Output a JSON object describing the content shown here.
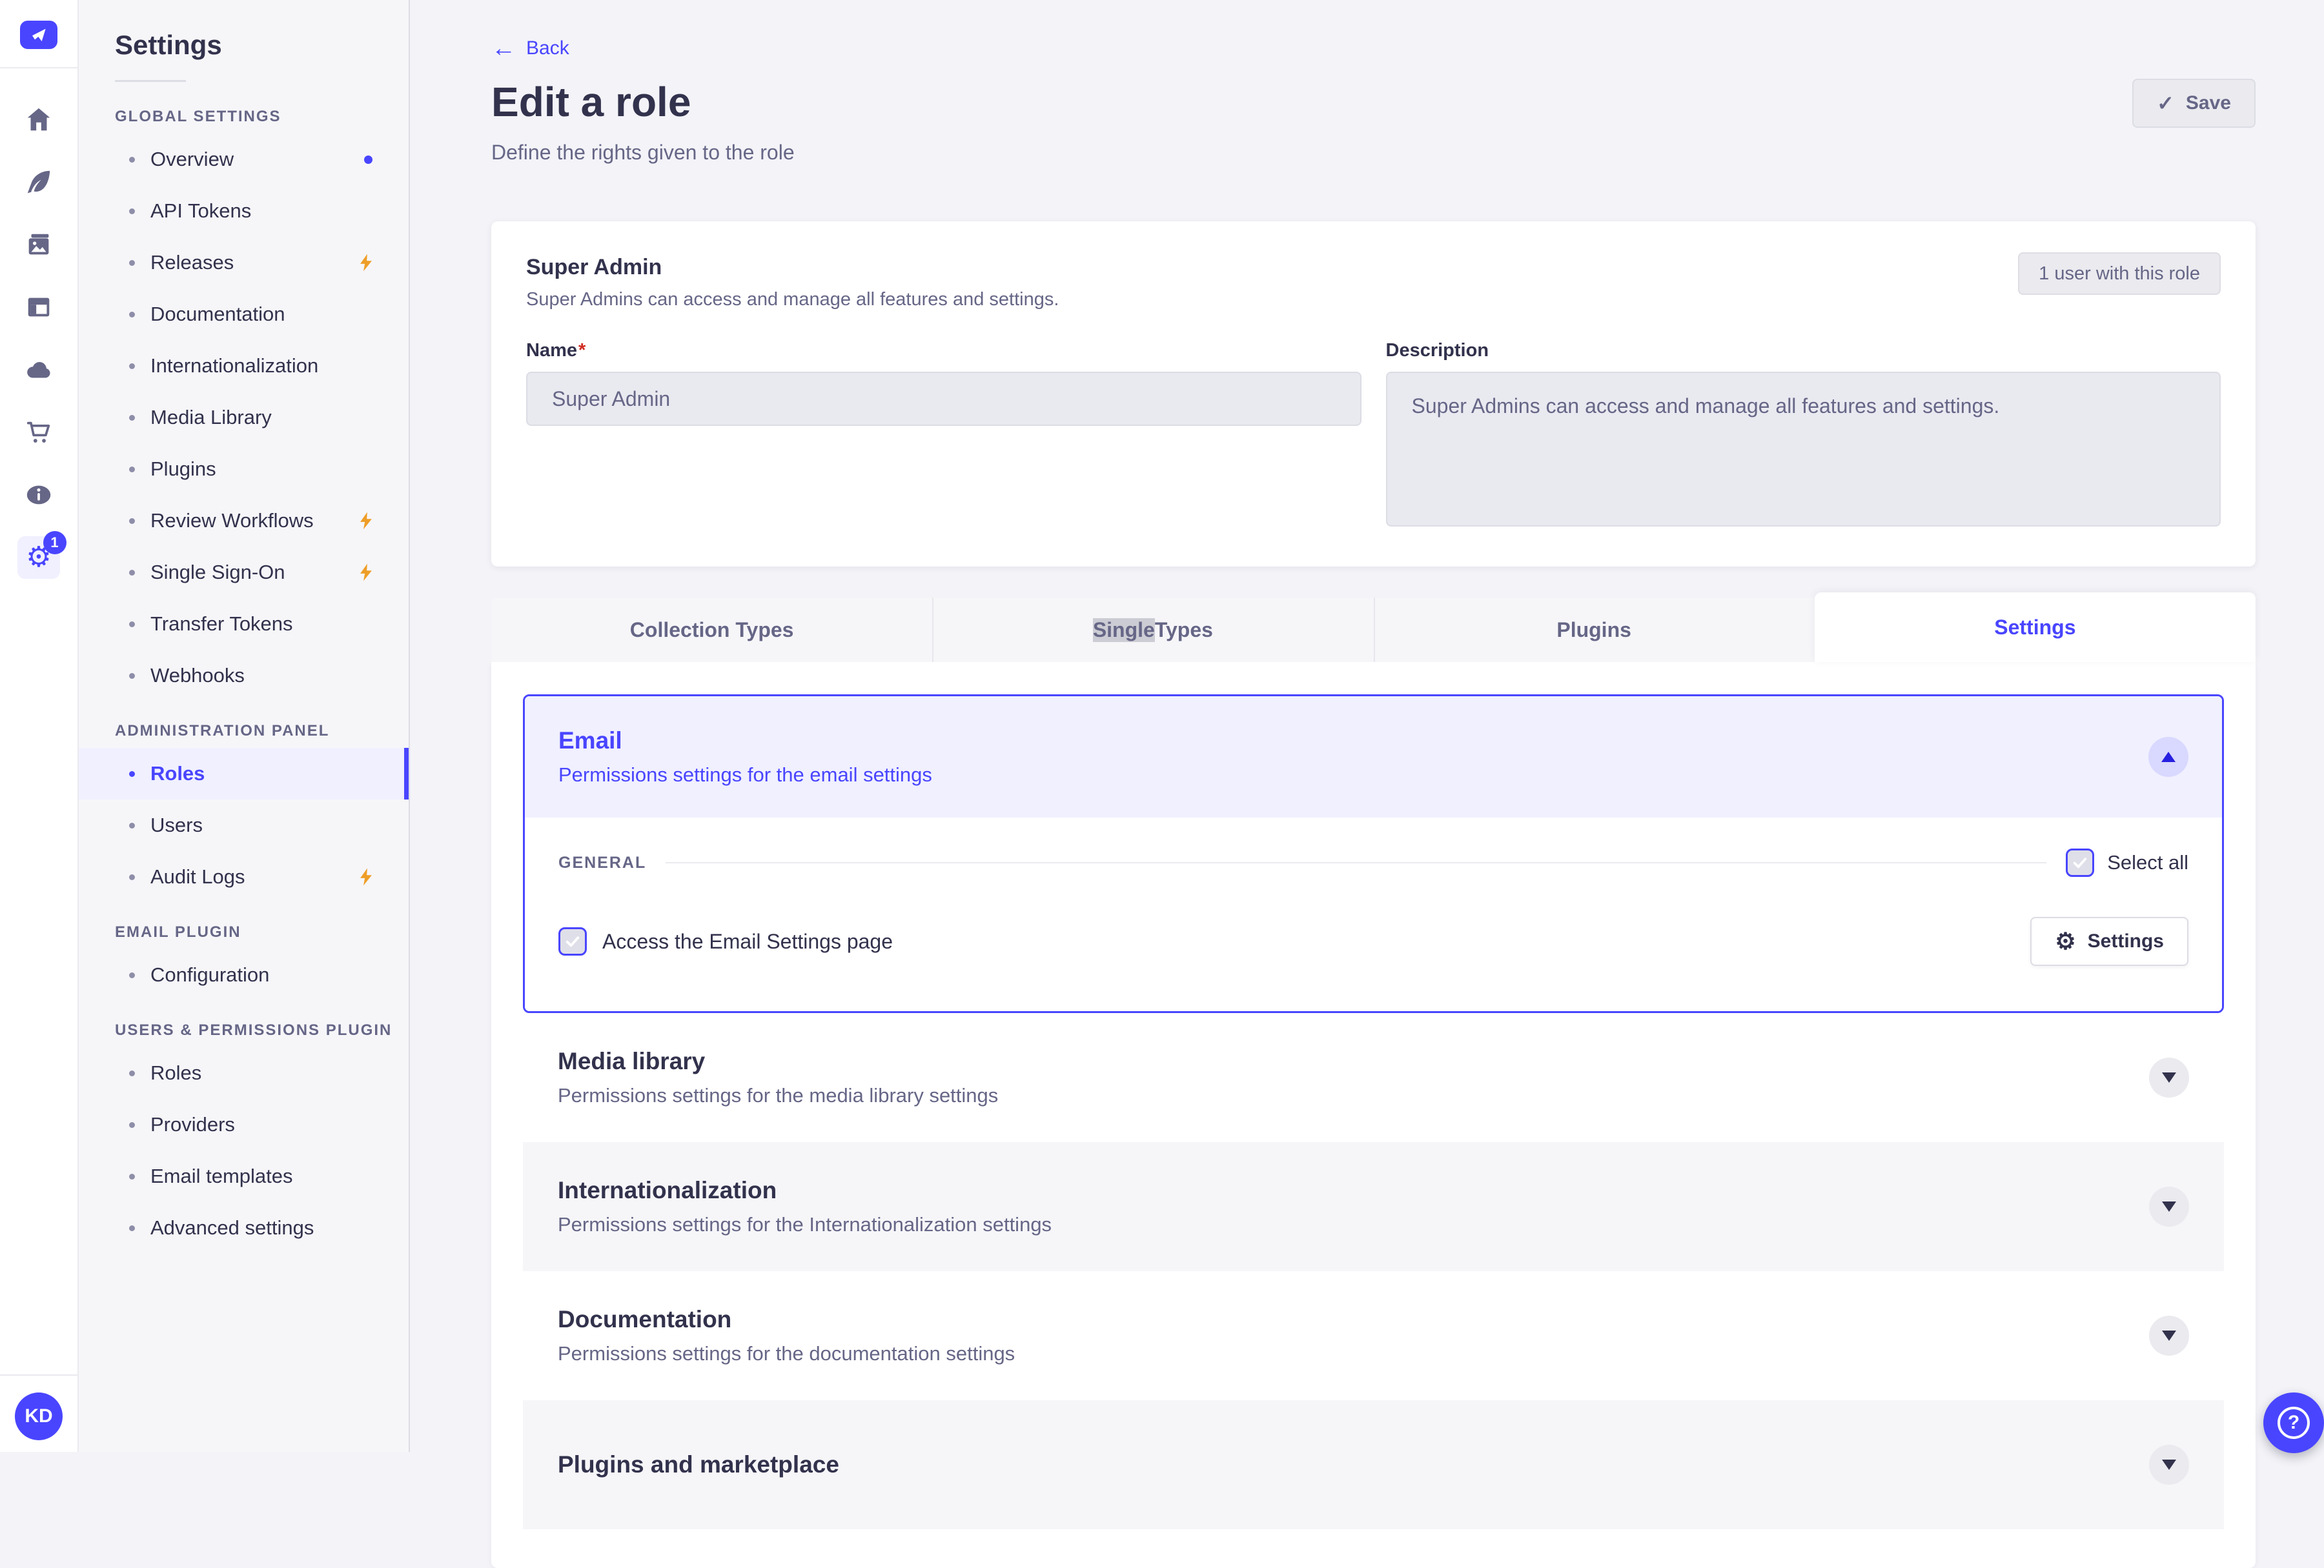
{
  "colors": {
    "accent": "#4945FF",
    "accent_bg": "#F0F0FF",
    "bolt_orange": "#EE9E27",
    "required_red": "#D02B20",
    "text_dark": "#32324D",
    "text_muted": "#666687",
    "page_bg": "#F6F6F9"
  },
  "nav_rail": {
    "icons": [
      {
        "name": "home-icon"
      },
      {
        "name": "content-manager-icon"
      },
      {
        "name": "media-library-icon"
      },
      {
        "name": "content-type-builder-icon"
      },
      {
        "name": "cloud-icon"
      },
      {
        "name": "marketplace-icon"
      },
      {
        "name": "information-icon"
      },
      {
        "name": "settings-icon",
        "active": true,
        "badge": "1"
      }
    ],
    "avatar_initials": "KD"
  },
  "sidebar": {
    "title": "Settings",
    "sections": [
      {
        "header": "GLOBAL SETTINGS",
        "items": [
          {
            "label": "Overview",
            "notification": true
          },
          {
            "label": "API Tokens"
          },
          {
            "label": "Releases",
            "lightning": true
          },
          {
            "label": "Documentation"
          },
          {
            "label": "Internationalization"
          },
          {
            "label": "Media Library"
          },
          {
            "label": "Plugins"
          },
          {
            "label": "Review Workflows",
            "lightning": true
          },
          {
            "label": "Single Sign-On",
            "lightning": true
          },
          {
            "label": "Transfer Tokens"
          },
          {
            "label": "Webhooks"
          }
        ]
      },
      {
        "header": "ADMINISTRATION PANEL",
        "items": [
          {
            "label": "Roles",
            "active": true
          },
          {
            "label": "Users"
          },
          {
            "label": "Audit Logs",
            "lightning": true
          }
        ]
      },
      {
        "header": "EMAIL PLUGIN",
        "items": [
          {
            "label": "Configuration"
          }
        ]
      },
      {
        "header": "USERS & PERMISSIONS PLUGIN",
        "items": [
          {
            "label": "Roles"
          },
          {
            "label": "Providers"
          },
          {
            "label": "Email templates"
          },
          {
            "label": "Advanced settings"
          }
        ]
      }
    ]
  },
  "header": {
    "back_label": "Back",
    "title": "Edit a role",
    "subtitle": "Define the rights given to the role",
    "save_label": "Save"
  },
  "role_card": {
    "title": "Super Admin",
    "subtitle": "Super Admins can access and manage all features and settings.",
    "users_button_label": "1 user with this role",
    "name_label": "Name",
    "name_required_mark": "*",
    "name_value": "Super Admin",
    "description_label": "Description",
    "description_value": "Super Admins can access and manage all features and settings."
  },
  "tabs": [
    {
      "label": "Collection Types"
    },
    {
      "label": "Single Types",
      "selected_text": "Single"
    },
    {
      "label": "Plugins"
    },
    {
      "label": "Settings",
      "active": true
    }
  ],
  "permissions_panel": {
    "expanded": {
      "title": "Email",
      "subtitle": "Permissions settings for the email settings",
      "section_label": "GENERAL",
      "select_all_label": "Select all",
      "select_all_checked": true,
      "permission_label": "Access the Email Settings page",
      "permission_checked": true,
      "settings_button_label": "Settings"
    },
    "collapsed": [
      {
        "title": "Media library",
        "subtitle": "Permissions settings for the media library settings"
      },
      {
        "title": "Internationalization",
        "subtitle": "Permissions settings for the Internationalization settings"
      },
      {
        "title": "Documentation",
        "subtitle": "Permissions settings for the documentation settings"
      },
      {
        "title": "Plugins and marketplace",
        "subtitle": ""
      }
    ]
  }
}
